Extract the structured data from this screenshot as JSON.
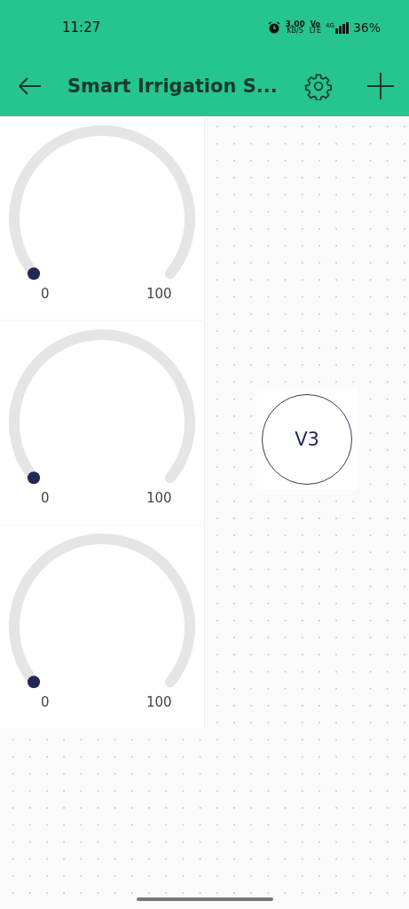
{
  "status_bar": {
    "time": "11:27",
    "speed_value": "3.00",
    "speed_unit": "KB/S",
    "volte_top": "Vo",
    "volte_bottom": "LTE",
    "network": "4G",
    "battery": "36%"
  },
  "app_bar": {
    "title": "Smart Irrigation S..."
  },
  "gauges": [
    {
      "min": "0",
      "max": "100"
    },
    {
      "min": "0",
      "max": "100"
    },
    {
      "min": "0",
      "max": "100"
    }
  ],
  "button_widget": {
    "label": "V3"
  }
}
